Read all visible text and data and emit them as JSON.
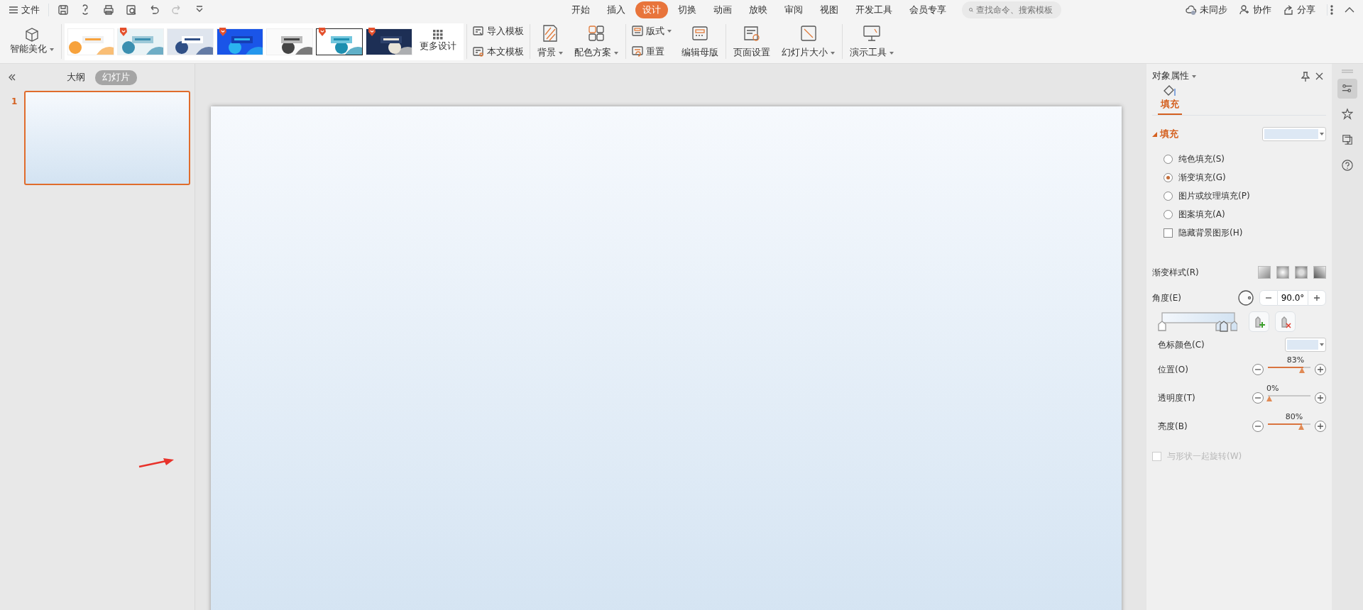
{
  "menu_bar": {
    "menu_label": "文件",
    "tabs": [
      {
        "label": "开始",
        "selected": false
      },
      {
        "label": "插入",
        "selected": false
      },
      {
        "label": "设计",
        "selected": true
      },
      {
        "label": "切换",
        "selected": false
      },
      {
        "label": "动画",
        "selected": false
      },
      {
        "label": "放映",
        "selected": false
      },
      {
        "label": "审阅",
        "selected": false
      },
      {
        "label": "视图",
        "selected": false
      },
      {
        "label": "开发工具",
        "selected": false
      },
      {
        "label": "会员专享",
        "selected": false
      }
    ],
    "search": {
      "placeholder": "查找命令、搜索模板"
    },
    "actions": [
      "未同步",
      "协作",
      "分享"
    ]
  },
  "ribbon": {
    "smart_beautify": {
      "label": "智能美化",
      "dropdown": true
    },
    "templates": [
      {
        "kind": "picture",
        "badge": false,
        "selected": false
      },
      {
        "kind": "picture",
        "badge": true,
        "selected": false
      },
      {
        "kind": "picture",
        "badge": false,
        "selected": false
      },
      {
        "kind": "picture",
        "badge": true,
        "selected": false
      },
      {
        "kind": "picture",
        "badge": false,
        "selected": false
      },
      {
        "kind": "picture",
        "badge": true,
        "selected": true
      },
      {
        "kind": "picture",
        "badge": true,
        "selected": false
      }
    ],
    "more_designs": "更多设计",
    "groups": [
      [
        {
          "kind": "stack",
          "items": [
            {
              "label": "导入模板",
              "dropdown": false
            },
            {
              "label": "本文模板",
              "dropdown": false
            }
          ]
        }
      ],
      [
        {
          "kind": "large",
          "label": "背景",
          "dropdown": true
        },
        {
          "kind": "large",
          "label": "配色方案",
          "dropdown": true
        }
      ],
      [
        {
          "kind": "stack",
          "items": [
            {
              "label": "版式",
              "dropdown": true
            },
            {
              "label": "重置",
              "dropdown": false
            }
          ]
        },
        {
          "kind": "large",
          "label": "编辑母版",
          "dropdown": false
        }
      ],
      [
        {
          "kind": "large",
          "label": "页面设置",
          "dropdown": false
        },
        {
          "kind": "large",
          "label": "幻灯片大小",
          "dropdown": true
        }
      ],
      [
        {
          "kind": "large",
          "label": "演示工具",
          "dropdown": true
        }
      ]
    ]
  },
  "side_panel": {
    "tabs": [
      {
        "label": "大纲",
        "selected": false
      },
      {
        "label": "幻灯片",
        "selected": true
      }
    ],
    "slides": [
      {
        "number": "1",
        "selected": true
      }
    ]
  },
  "properties": {
    "title": "对象属性",
    "tabs": [
      {
        "label": "填充",
        "selected": true
      }
    ],
    "section": {
      "label": "填充",
      "expanded": true
    },
    "options": [
      {
        "kind": "radio",
        "label": "纯色填充(S)",
        "selected": false
      },
      {
        "kind": "radio",
        "label": "渐变填充(G)",
        "selected": true
      },
      {
        "kind": "radio",
        "label": "图片或纹理填充(P)",
        "selected": false
      },
      {
        "kind": "radio",
        "label": "图案填充(A)",
        "selected": false
      },
      {
        "kind": "checkbox",
        "label": "隐藏背景图形(H)",
        "checked": false
      }
    ],
    "gradient_style_label": "渐变样式(R)",
    "angle": {
      "label": "角度(E)",
      "value": "90.0°"
    },
    "stop_color_label": "色标颜色(C)",
    "sliders": [
      {
        "label": "位置(O)",
        "level": 0.83,
        "reading": "83%"
      },
      {
        "label": "透明度(T)",
        "level": 0,
        "reading": "0%"
      },
      {
        "label": "亮度(B)",
        "level": 0.8,
        "reading": "80%"
      }
    ],
    "rotate_option": {
      "label": "与形状一起旋转(W)",
      "checked": false,
      "disabled": true
    }
  },
  "tool_strip": [
    {
      "selected": true
    },
    {
      "selected": false
    },
    {
      "selected": false
    },
    {
      "selected": false
    }
  ]
}
